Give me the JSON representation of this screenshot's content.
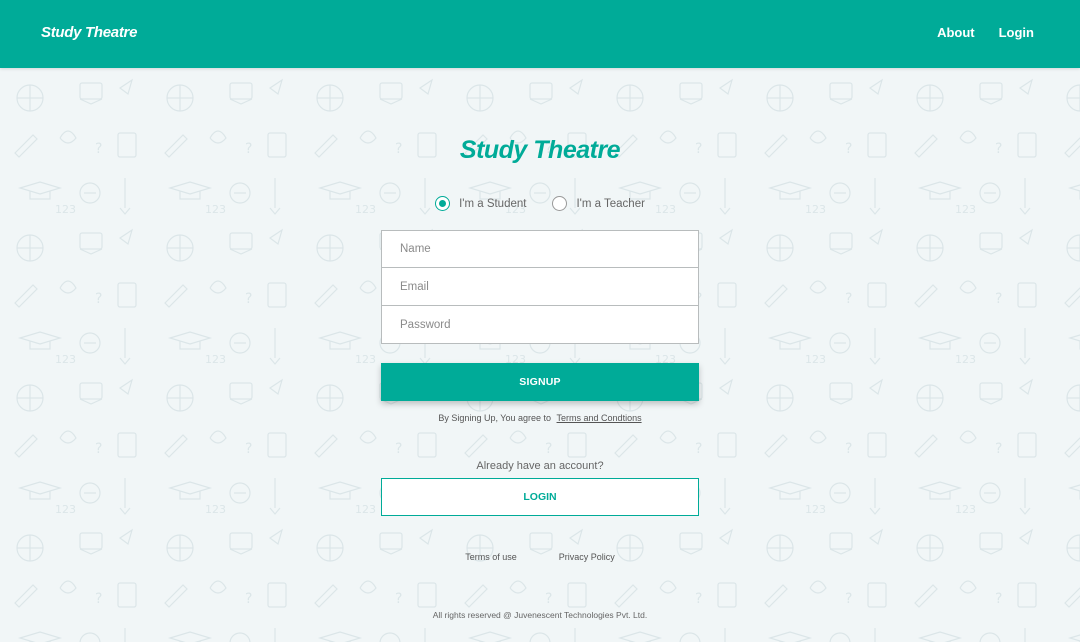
{
  "nav": {
    "brand": "Study Theatre",
    "links": [
      "About",
      "Login"
    ]
  },
  "main": {
    "title": "Study Theatre",
    "roles": [
      {
        "label": "I'm a Student",
        "selected": true
      },
      {
        "label": "I'm a Teacher",
        "selected": false
      }
    ],
    "fields": {
      "name_placeholder": "Name",
      "email_placeholder": "Email",
      "password_placeholder": "Password"
    },
    "signup_label": "SIGNUP",
    "terms_prefix": "By Signing Up, You agree to",
    "terms_link": "Terms and Condtions",
    "already_text": "Already have an account?",
    "login_label": "LOGIN"
  },
  "footer": {
    "links": [
      "Terms of use",
      "Privacy Policy"
    ],
    "copyright": "All rights reserved @ Juvenescent Technologies Pvt. Ltd."
  },
  "colors": {
    "accent": "#00ab98",
    "background": "#f1f6f7"
  },
  "icons": [
    "radio-checked-icon",
    "radio-unchecked-icon"
  ]
}
